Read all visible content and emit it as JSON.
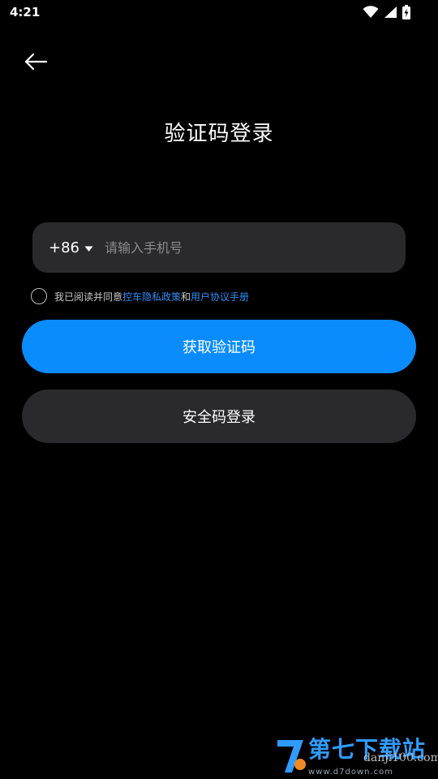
{
  "status_bar": {
    "time": "4:21",
    "icons": [
      "wifi-icon",
      "cell-signal-icon",
      "battery-charging-icon"
    ]
  },
  "header": {
    "back_icon": "arrow-left-icon",
    "title": "验证码登录"
  },
  "phone": {
    "country_code": "+86",
    "dropdown_icon": "caret-down-icon",
    "placeholder": "请输入手机号",
    "value": ""
  },
  "agreement": {
    "prefix": "我已阅读并同意",
    "privacy_link": "控车隐私政策",
    "conjunction": "和",
    "terms_link": "用户协议手册",
    "checked": false
  },
  "actions": {
    "get_code_label": "获取验证码",
    "security_code_label": "安全码登录"
  },
  "colors": {
    "background": "#000000",
    "primary": "#0a8cff",
    "field": "#2a2a2c",
    "link": "#2f8df7"
  },
  "watermark": {
    "title": "第七下载站",
    "site": "danji100.com",
    "url": "www.d7down.com"
  }
}
